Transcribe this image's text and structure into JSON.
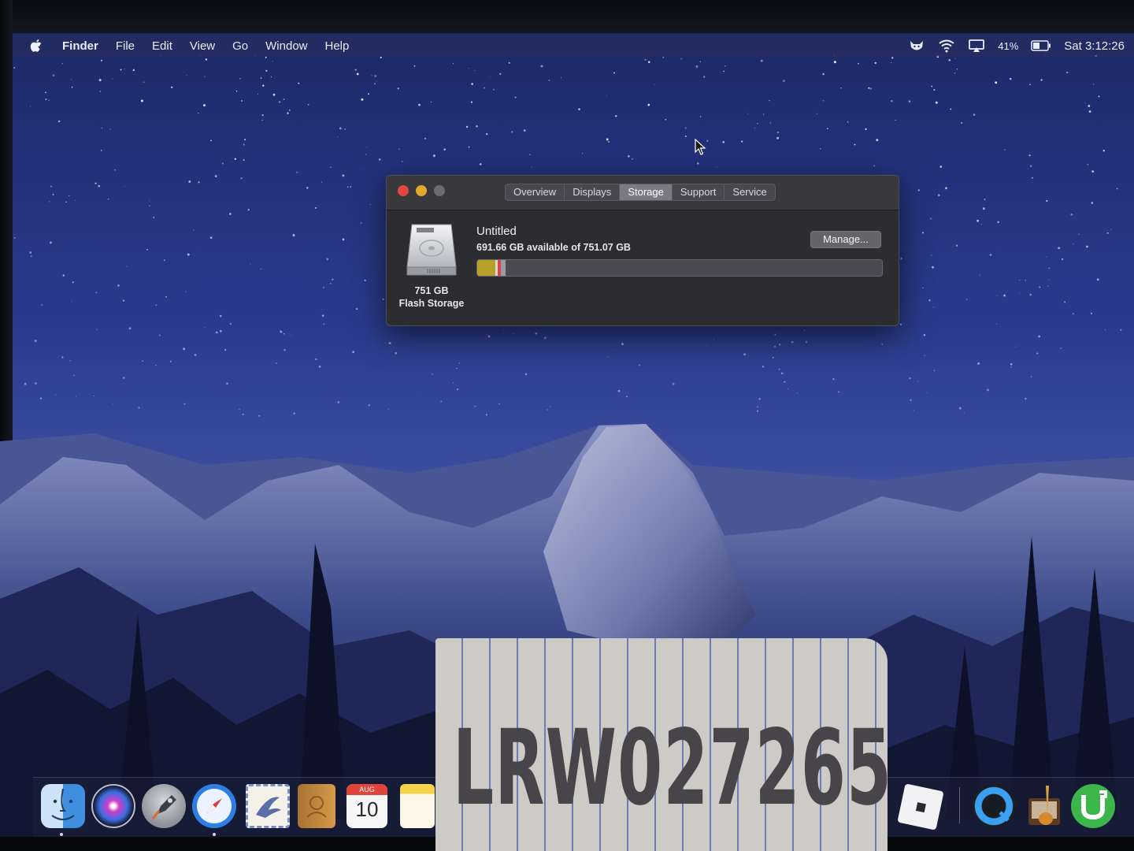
{
  "menubar": {
    "app_name": "Finder",
    "items": [
      "File",
      "Edit",
      "View",
      "Go",
      "Window",
      "Help"
    ],
    "battery_percent": "41%",
    "clock": "Sat 3:12:26",
    "status_icons": [
      "cat-icon",
      "wifi-icon",
      "airplay-icon",
      "battery-icon"
    ]
  },
  "about_window": {
    "tabs": [
      "Overview",
      "Displays",
      "Storage",
      "Support",
      "Service"
    ],
    "active_tab": "Storage",
    "disk_size": "751 GB",
    "disk_type": "Flash Storage",
    "volume_name": "Untitled",
    "available_text": "691.66 GB available of 751.07 GB",
    "manage_label": "Manage...",
    "storage_segments": [
      {
        "name": "apps",
        "fraction": 0.045,
        "color": "#b8a12a"
      },
      {
        "name": "other",
        "fraction": 0.006,
        "color": "#d8d8d8"
      },
      {
        "name": "system",
        "fraction": 0.008,
        "color": "#d6454a"
      },
      {
        "name": "misc",
        "fraction": 0.012,
        "color": "#9a9aa0"
      }
    ],
    "free_color": "#4a4a50"
  },
  "dock": {
    "apps": [
      "finder",
      "siri",
      "launchpad",
      "safari",
      "mail",
      "contacts",
      "calendar",
      "notes",
      "roblox",
      "quicktime",
      "garageband",
      "utorrent"
    ],
    "calendar_month": "AUG",
    "calendar_day": "10"
  },
  "paper_note": {
    "text": "LRW027265"
  }
}
